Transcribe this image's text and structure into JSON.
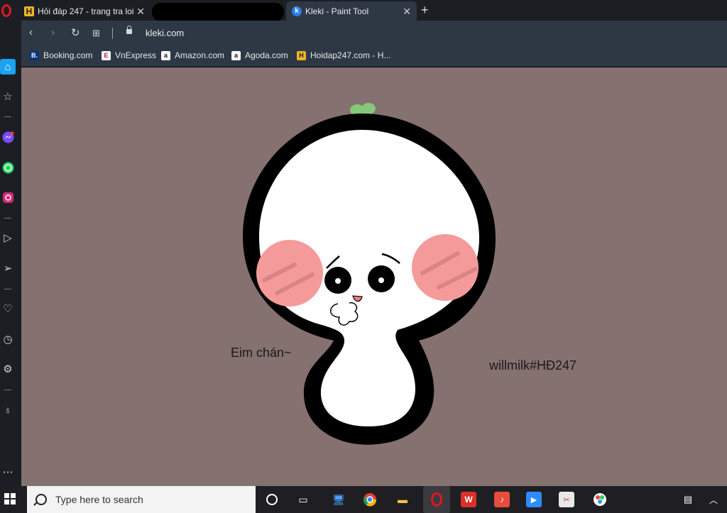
{
  "browser": {
    "tabs": [
      {
        "title": "Hỏi đáp 247 - trang tra loi",
        "icon": "hoidap-favicon"
      },
      {
        "title": "",
        "icon": "redacted"
      },
      {
        "title": "Kleki - Paint Tool",
        "icon": "kleki-favicon"
      }
    ],
    "url": "kleki.com",
    "bookmarks": [
      {
        "label": "Booking.com",
        "glyph": "B."
      },
      {
        "label": "VnExpress",
        "glyph": "E"
      },
      {
        "label": "Amazon.com",
        "glyph": "a"
      },
      {
        "label": "Agoda.com",
        "glyph": "a"
      },
      {
        "label": "Hoidap247.com - H...",
        "glyph": "H"
      }
    ]
  },
  "canvas": {
    "text_left": "Eim chán~",
    "text_right": "willmilk#HĐ247",
    "background_color": "#857170"
  },
  "taskbar": {
    "search_placeholder": "Type here to search"
  },
  "colors": {
    "opera_red": "#e0161f",
    "blush": "#f59a9a",
    "sprout": "#86c77a"
  }
}
